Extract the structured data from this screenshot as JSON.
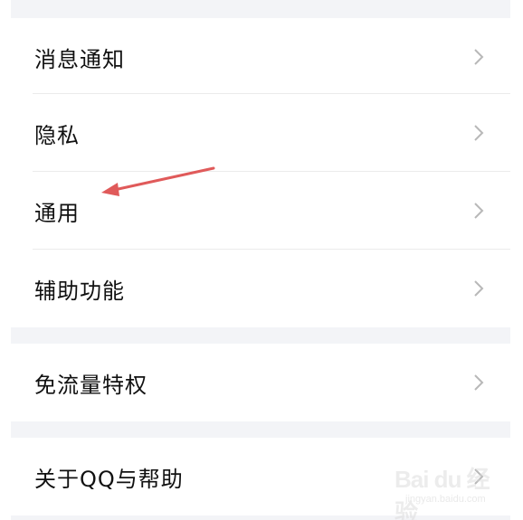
{
  "settings": {
    "items": [
      {
        "label": "消息通知",
        "icon": "chevron-right-icon"
      },
      {
        "label": "隐私",
        "icon": "chevron-right-icon"
      },
      {
        "label": "通用",
        "icon": "chevron-right-icon"
      },
      {
        "label": "辅助功能",
        "icon": "chevron-right-icon"
      },
      {
        "label": "免流量特权",
        "icon": "chevron-right-icon"
      },
      {
        "label": "关于QQ与帮助",
        "icon": "chevron-right-icon"
      }
    ]
  },
  "annotation": {
    "arrow_color": "#e05a5a",
    "points_to": "通用"
  },
  "watermark": {
    "brand": "Bai du 经验",
    "domain": "jingyan.baidu.com"
  },
  "colors": {
    "background": "#ffffff",
    "section_gap": "#f3f4f7",
    "text": "#111111",
    "chevron": "#b8b8b8",
    "divider": "#ebebeb"
  }
}
